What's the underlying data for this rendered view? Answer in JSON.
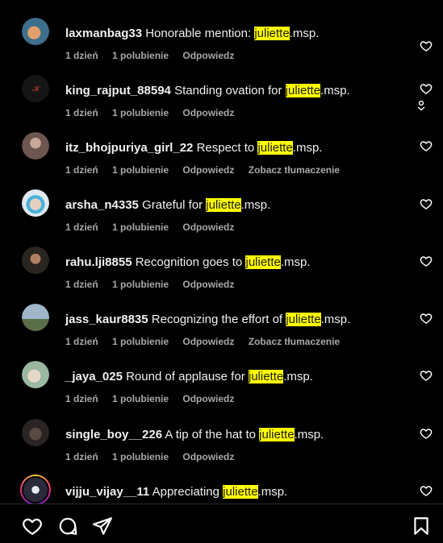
{
  "comments": [
    {
      "username": "laxmanbag33",
      "pre": "Honorable mention: ",
      "tag": "juliette",
      "post": ".msp.",
      "time": "1 dzień",
      "likes": "1 polubienie",
      "reply": "Odpowiedz",
      "translate": "",
      "avatar_color": "#c97a4a"
    },
    {
      "username": "king_rajput_88594",
      "pre": "Standing ovation for ",
      "tag": "juliette",
      "post": ".msp.",
      "time": "1 dzień",
      "likes": "1 polubienie",
      "reply": "Odpowiedz",
      "translate": "",
      "avatar_color": "#1a1a1a"
    },
    {
      "username": "itz_bhojpuriya_girl_22",
      "pre": "Respect to ",
      "tag": "juliette",
      "post": ".msp.",
      "time": "1 dzień",
      "likes": "1 polubienie",
      "reply": "Odpowiedz",
      "translate": "Zobacz tłumaczenie",
      "avatar_color": "#8a6e66"
    },
    {
      "username": "arsha_n4335",
      "pre": "Grateful for ",
      "tag": "juliette",
      "post": ".msp.",
      "time": "1 dzień",
      "likes": "1 polubienie",
      "reply": "Odpowiedz",
      "translate": "",
      "avatar_color": "#bcd4e6"
    },
    {
      "username": "rahu.lji8855",
      "pre": "Recognition goes to ",
      "tag": "juliette",
      "post": ".msp.",
      "time": "1 dzień",
      "likes": "1 polubienie",
      "reply": "Odpowiedz",
      "translate": "",
      "avatar_color": "#4a3a30"
    },
    {
      "username": "jass_kaur8835",
      "pre": "Recognizing the effort of ",
      "tag": "juliette",
      "post": ".msp.",
      "time": "1 dzień",
      "likes": "1 polubienie",
      "reply": "Odpowiedz",
      "translate": "Zobacz tłumaczenie",
      "avatar_color": "#8fa6b8"
    },
    {
      "username": "_jaya_025",
      "pre": "Round of applause for ",
      "tag": "juliette",
      "post": ".msp.",
      "time": "1 dzień",
      "likes": "1 polubienie",
      "reply": "Odpowiedz",
      "translate": "",
      "avatar_color": "#c8d6c0"
    },
    {
      "username": "single_boy__226",
      "pre": "A tip of the hat to ",
      "tag": "juliette",
      "post": ".msp.",
      "time": "1 dzień",
      "likes": "1 polubienie",
      "reply": "Odpowiedz",
      "translate": "",
      "avatar_color": "#3a3232"
    },
    {
      "username": "vijju_vijay__11",
      "pre": "Appreciating ",
      "tag": "juliette",
      "post": ".msp.",
      "time": "",
      "likes": "",
      "reply": "",
      "translate": "",
      "avatar_color": "#223"
    }
  ],
  "colors": {
    "background": "#000000",
    "highlight": "#ffff00",
    "meta": "#a8a8a8"
  },
  "icons": {
    "like": "heart-outline-icon",
    "bottom_bar": [
      "heart-outline-icon",
      "comment-icon",
      "share-send-icon",
      "bookmark-icon"
    ]
  }
}
